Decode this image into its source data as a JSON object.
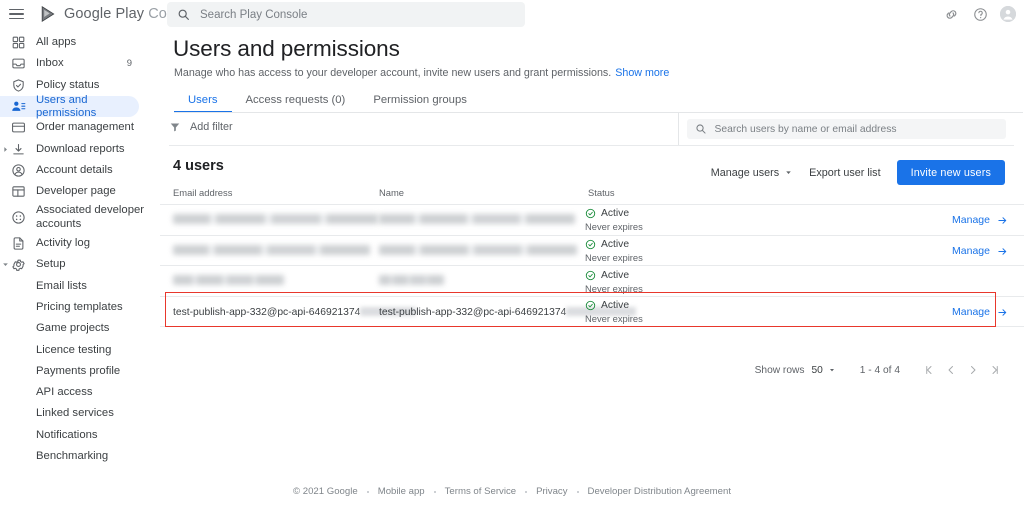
{
  "topbar": {
    "menu_icon": "hamburger-icon",
    "logo_brand": "Google Play",
    "logo_suffix": "Console",
    "search_placeholder": "Search Play Console",
    "icons": [
      "link-icon",
      "help-icon",
      "account-avatar"
    ]
  },
  "sidebar": {
    "items": [
      {
        "label": "All apps",
        "icon": "grid-apps-icon",
        "active": false,
        "badge": ""
      },
      {
        "label": "Inbox",
        "icon": "inbox-icon",
        "active": false,
        "badge": "9"
      },
      {
        "label": "Policy status",
        "icon": "shield-check-icon",
        "active": false,
        "badge": ""
      },
      {
        "label": "Users and permissions",
        "icon": "users-icon",
        "active": true,
        "badge": ""
      },
      {
        "label": "Order management",
        "icon": "card-icon",
        "active": false,
        "badge": ""
      },
      {
        "label": "Download reports",
        "icon": "download-icon",
        "active": false,
        "badge": "",
        "expandable": "right"
      },
      {
        "label": "Account details",
        "icon": "account-circle-icon",
        "active": false,
        "badge": ""
      },
      {
        "label": "Developer page",
        "icon": "page-layout-icon",
        "active": false,
        "badge": ""
      },
      {
        "label": "Associated developer accounts",
        "icon": "associated-accounts-icon",
        "active": false,
        "badge": ""
      },
      {
        "label": "Activity log",
        "icon": "document-icon",
        "active": false,
        "badge": ""
      },
      {
        "label": "Setup",
        "icon": "gear-icon",
        "active": false,
        "badge": "",
        "expandable": "down"
      }
    ],
    "sub_items": [
      "Email lists",
      "Pricing templates",
      "Game projects",
      "Licence testing",
      "Payments profile",
      "API access",
      "Linked services",
      "Notifications",
      "Benchmarking"
    ]
  },
  "page": {
    "title": "Users and permissions",
    "subtitle": "Manage who has access to your developer account, invite new users and grant permissions.",
    "show_more": "Show more",
    "tabs": [
      {
        "label": "Users",
        "selected": true
      },
      {
        "label": "Access requests (0)",
        "selected": false
      },
      {
        "label": "Permission groups",
        "selected": false
      }
    ]
  },
  "filters": {
    "add_filter_label": "Add filter",
    "filter_icon": "filter-funnel-icon",
    "user_search_placeholder": "Search users by name or email address",
    "search_icon": "search-icon"
  },
  "toolbar": {
    "count_label": "4 users",
    "manage_users_label": "Manage users",
    "export_label": "Export user list",
    "invite_label": "Invite new users",
    "accent_color": "#1a73e8"
  },
  "table": {
    "columns": [
      "Email address",
      "Name",
      "Status"
    ],
    "status_active_color": "#1e8e3e",
    "rows": [
      {
        "email": "",
        "email_redacted": true,
        "email_redact_width": 205,
        "name": "",
        "name_redacted": true,
        "name_redact_width": 196,
        "status": "Active",
        "expiry": "Never expires",
        "manage_label": "Manage",
        "has_manage": true,
        "highlighted": false
      },
      {
        "email": "",
        "email_redacted": true,
        "email_redact_width": 197,
        "name": "",
        "name_redacted": true,
        "name_redact_width": 198,
        "status": "Active",
        "expiry": "Never expires",
        "manage_label": "Manage",
        "has_manage": true,
        "highlighted": false
      },
      {
        "email": "",
        "email_redacted": true,
        "email_redact_width": 111,
        "name": "",
        "name_redacted": true,
        "name_redact_width": 65,
        "status": "Active",
        "expiry": "Never expires",
        "manage_label": "",
        "has_manage": false,
        "highlighted": false
      },
      {
        "email": "test-publish-app-332@pc-api-646921374",
        "email_redacted": true,
        "email_redact_width": 56,
        "name": "test-publish-app-332@pc-api-646921374",
        "name_redacted": true,
        "name_redact_width": 70,
        "status": "Active",
        "expiry": "Never expires",
        "manage_label": "Manage",
        "has_manage": true,
        "highlighted": true
      }
    ]
  },
  "pagination": {
    "show_rows_label": "Show rows",
    "rows_per_page": "50",
    "range_label": "1 - 4 of 4",
    "first_icon": "first-page-icon",
    "prev_icon": "prev-page-icon",
    "next_icon": "next-page-icon",
    "last_icon": "last-page-icon"
  },
  "footer": {
    "copyright": "© 2021 Google",
    "links": [
      "Mobile app",
      "Terms of Service",
      "Privacy",
      "Developer Distribution Agreement"
    ]
  }
}
